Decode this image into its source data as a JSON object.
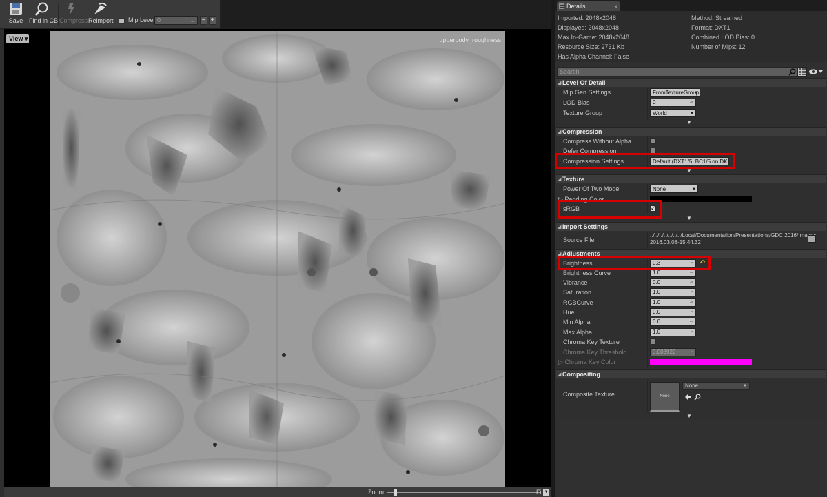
{
  "toolbar": {
    "save_label": "Save",
    "find_label": "Find in CB",
    "compress_label": "Compress",
    "reimport_label": "Reimport",
    "mip_level_label": "Mip Level:",
    "mip_level_value": "0",
    "minus": "−",
    "plus": "+"
  },
  "viewport": {
    "view_label": "View",
    "texture_name": "upperbody_roughness",
    "zoom_label": "Zoom:",
    "fit_label": "Fit"
  },
  "details": {
    "tab_label": "Details",
    "tab_close": "x",
    "info": {
      "imported": "Imported: 2048x2048",
      "displayed": "Displayed: 2048x2048",
      "max_in_game": "Max In-Game: 2048x2048",
      "resource_size": "Resource Size: 2731 Kb",
      "has_alpha": "Has Alpha Channel: False",
      "method": "Method: Streamed",
      "format": "Format: DXT1",
      "combined_lod": "Combined LOD Bias: 0",
      "num_mips": "Number of Mips: 12"
    },
    "search_placeholder": "Search",
    "categories": {
      "lod": {
        "title": "Level Of Detail",
        "mip_gen_label": "Mip Gen Settings",
        "mip_gen_value": "FromTextureGroup",
        "lod_bias_label": "LOD Bias",
        "lod_bias_value": "0",
        "texture_group_label": "Texture Group",
        "texture_group_value": "World"
      },
      "compression": {
        "title": "Compression",
        "compress_no_alpha_label": "Compress Without Alpha",
        "compress_no_alpha_checked": false,
        "defer_label": "Defer Compression",
        "defer_checked": false,
        "settings_label": "Compression Settings",
        "settings_value": "Default (DXT1/5, BC1/5 on DX11)"
      },
      "texture": {
        "title": "Texture",
        "pot_label": "Power Of Two Mode",
        "pot_value": "None",
        "padding_label": "Padding Color",
        "padding_color": "#000000",
        "srgb_label": "sRGB",
        "srgb_checked": true
      },
      "import": {
        "title": "Import Settings",
        "source_label": "Source File",
        "source_path": "../../../../../../../Local/Documentation/Presentations/GDC 2016/Images",
        "source_time": "2016.03.08-15.44.32",
        "browse_label": "..."
      },
      "adjustments": {
        "title": "Adjustments",
        "brightness_label": "Brightness",
        "brightness_value": "0.3",
        "brightness_curve_label": "Brightness Curve",
        "brightness_curve_value": "1.0",
        "vibrance_label": "Vibrance",
        "vibrance_value": "0.0",
        "saturation_label": "Saturation",
        "saturation_value": "1.0",
        "rgbcurve_label": "RGBCurve",
        "rgbcurve_value": "1.0",
        "hue_label": "Hue",
        "hue_value": "0.0",
        "min_alpha_label": "Min Alpha",
        "min_alpha_value": "0.0",
        "max_alpha_label": "Max Alpha",
        "max_alpha_value": "1.0",
        "chroma_texture_label": "Chroma Key Texture",
        "chroma_texture_checked": false,
        "chroma_threshold_label": "Chroma Key Threshold",
        "chroma_threshold_value": "0.003922",
        "chroma_color_label": "Chroma Key Color",
        "chroma_color": "#ff00ff"
      },
      "compositing": {
        "title": "Compositing",
        "composite_texture_label": "Composite Texture",
        "thumb_text": "None",
        "asset_value": "None"
      }
    }
  },
  "colors": {
    "highlight": "#d60000",
    "reset_arrow": "#e0c020",
    "chroma": "#ff00ff"
  }
}
